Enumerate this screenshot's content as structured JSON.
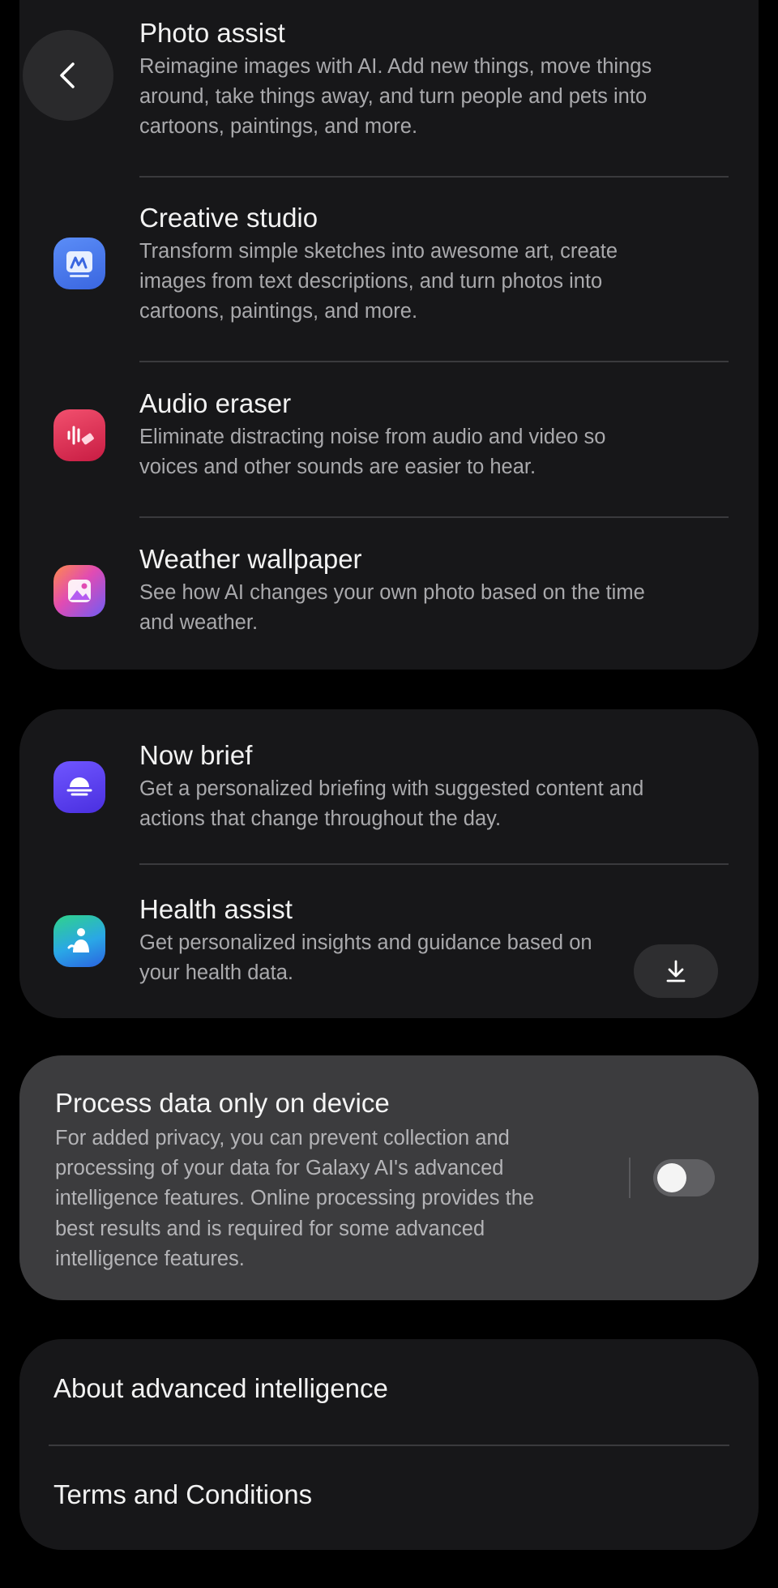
{
  "features_top": [
    {
      "title": "Photo assist",
      "desc": "Reimagine images with AI. Add new things, move things around, take things away, and turn people and pets into cartoons, paintings, and more.",
      "icon": "photo-assist-icon"
    },
    {
      "title": "Creative studio",
      "desc": "Transform simple sketches into awesome art, create images from text descriptions, and turn photos into cartoons, paintings, and more.",
      "icon": "creative-studio-icon"
    },
    {
      "title": "Audio eraser",
      "desc": "Eliminate distracting noise from audio and video so voices and other sounds are easier to hear.",
      "icon": "audio-eraser-icon"
    },
    {
      "title": "Weather wallpaper",
      "desc": "See how AI changes your own photo based on the time and weather.",
      "icon": "weather-wallpaper-icon"
    }
  ],
  "features_mid": [
    {
      "title": "Now brief",
      "desc": "Get a personalized briefing with suggested content and actions that change throughout the day.",
      "icon": "now-brief-icon"
    },
    {
      "title": "Health assist",
      "desc": "Get personalized insights and guidance based on your health data.",
      "icon": "health-assist-icon"
    }
  ],
  "privacy": {
    "title": "Process data only on device",
    "desc": "For added privacy, you can prevent collection and processing of your data for Galaxy AI's advanced intelligence features. Online processing provides the best results and is required for some advanced intelligence features.",
    "toggle_on": false
  },
  "links": {
    "about": "About advanced intelligence",
    "terms": "Terms and Conditions"
  },
  "colors": {
    "background": "#000000",
    "card": "#171719",
    "privacy_card": "#3c3c3e",
    "title_text": "#f2f2f2",
    "desc_text": "#a9a9ac"
  }
}
